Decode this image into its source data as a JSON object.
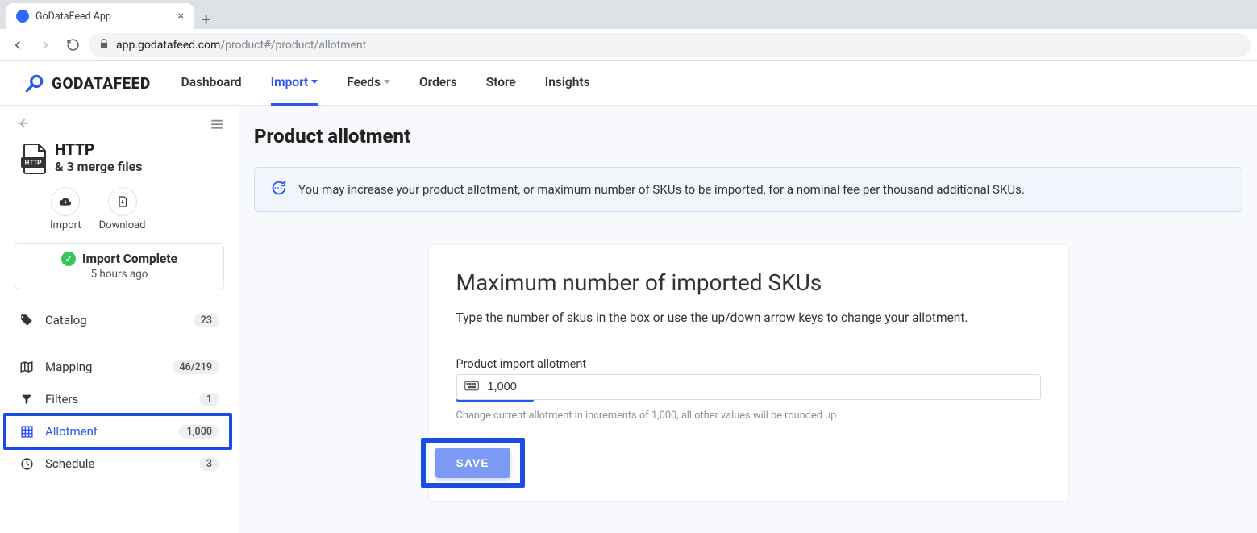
{
  "browser": {
    "tab_title": "GoDataFeed App",
    "url_host": "app.godatafeed.com",
    "url_path": "/product#/product/allotment"
  },
  "nav": {
    "brand": "GODATAFEED",
    "items": [
      "Dashboard",
      "Import",
      "Feeds",
      "Orders",
      "Store",
      "Insights"
    ]
  },
  "sidebar": {
    "source_title": "HTTP",
    "source_subtitle": "& 3 merge files",
    "actions": {
      "import": "Import",
      "download": "Download"
    },
    "status": {
      "text": "Import Complete",
      "time": "5 hours ago"
    },
    "items": [
      {
        "label": "Catalog",
        "badge": "23"
      },
      {
        "label": "Mapping",
        "badge": "46/219"
      },
      {
        "label": "Filters",
        "badge": "1"
      },
      {
        "label": "Allotment",
        "badge": "1,000"
      },
      {
        "label": "Schedule",
        "badge": "3"
      }
    ]
  },
  "main": {
    "title": "Product allotment",
    "banner": "You may increase your product allotment, or maximum number of SKUs to be imported, for a nominal fee per thousand additional SKUs.",
    "card": {
      "heading": "Maximum number of imported SKUs",
      "description": "Type the number of skus in the box or use the up/down arrow keys to change your allotment.",
      "field_label": "Product import allotment",
      "field_value": "1,000",
      "helper": "Change current allotment in increments of 1,000, all other values will be rounded up",
      "save": "SAVE"
    }
  }
}
